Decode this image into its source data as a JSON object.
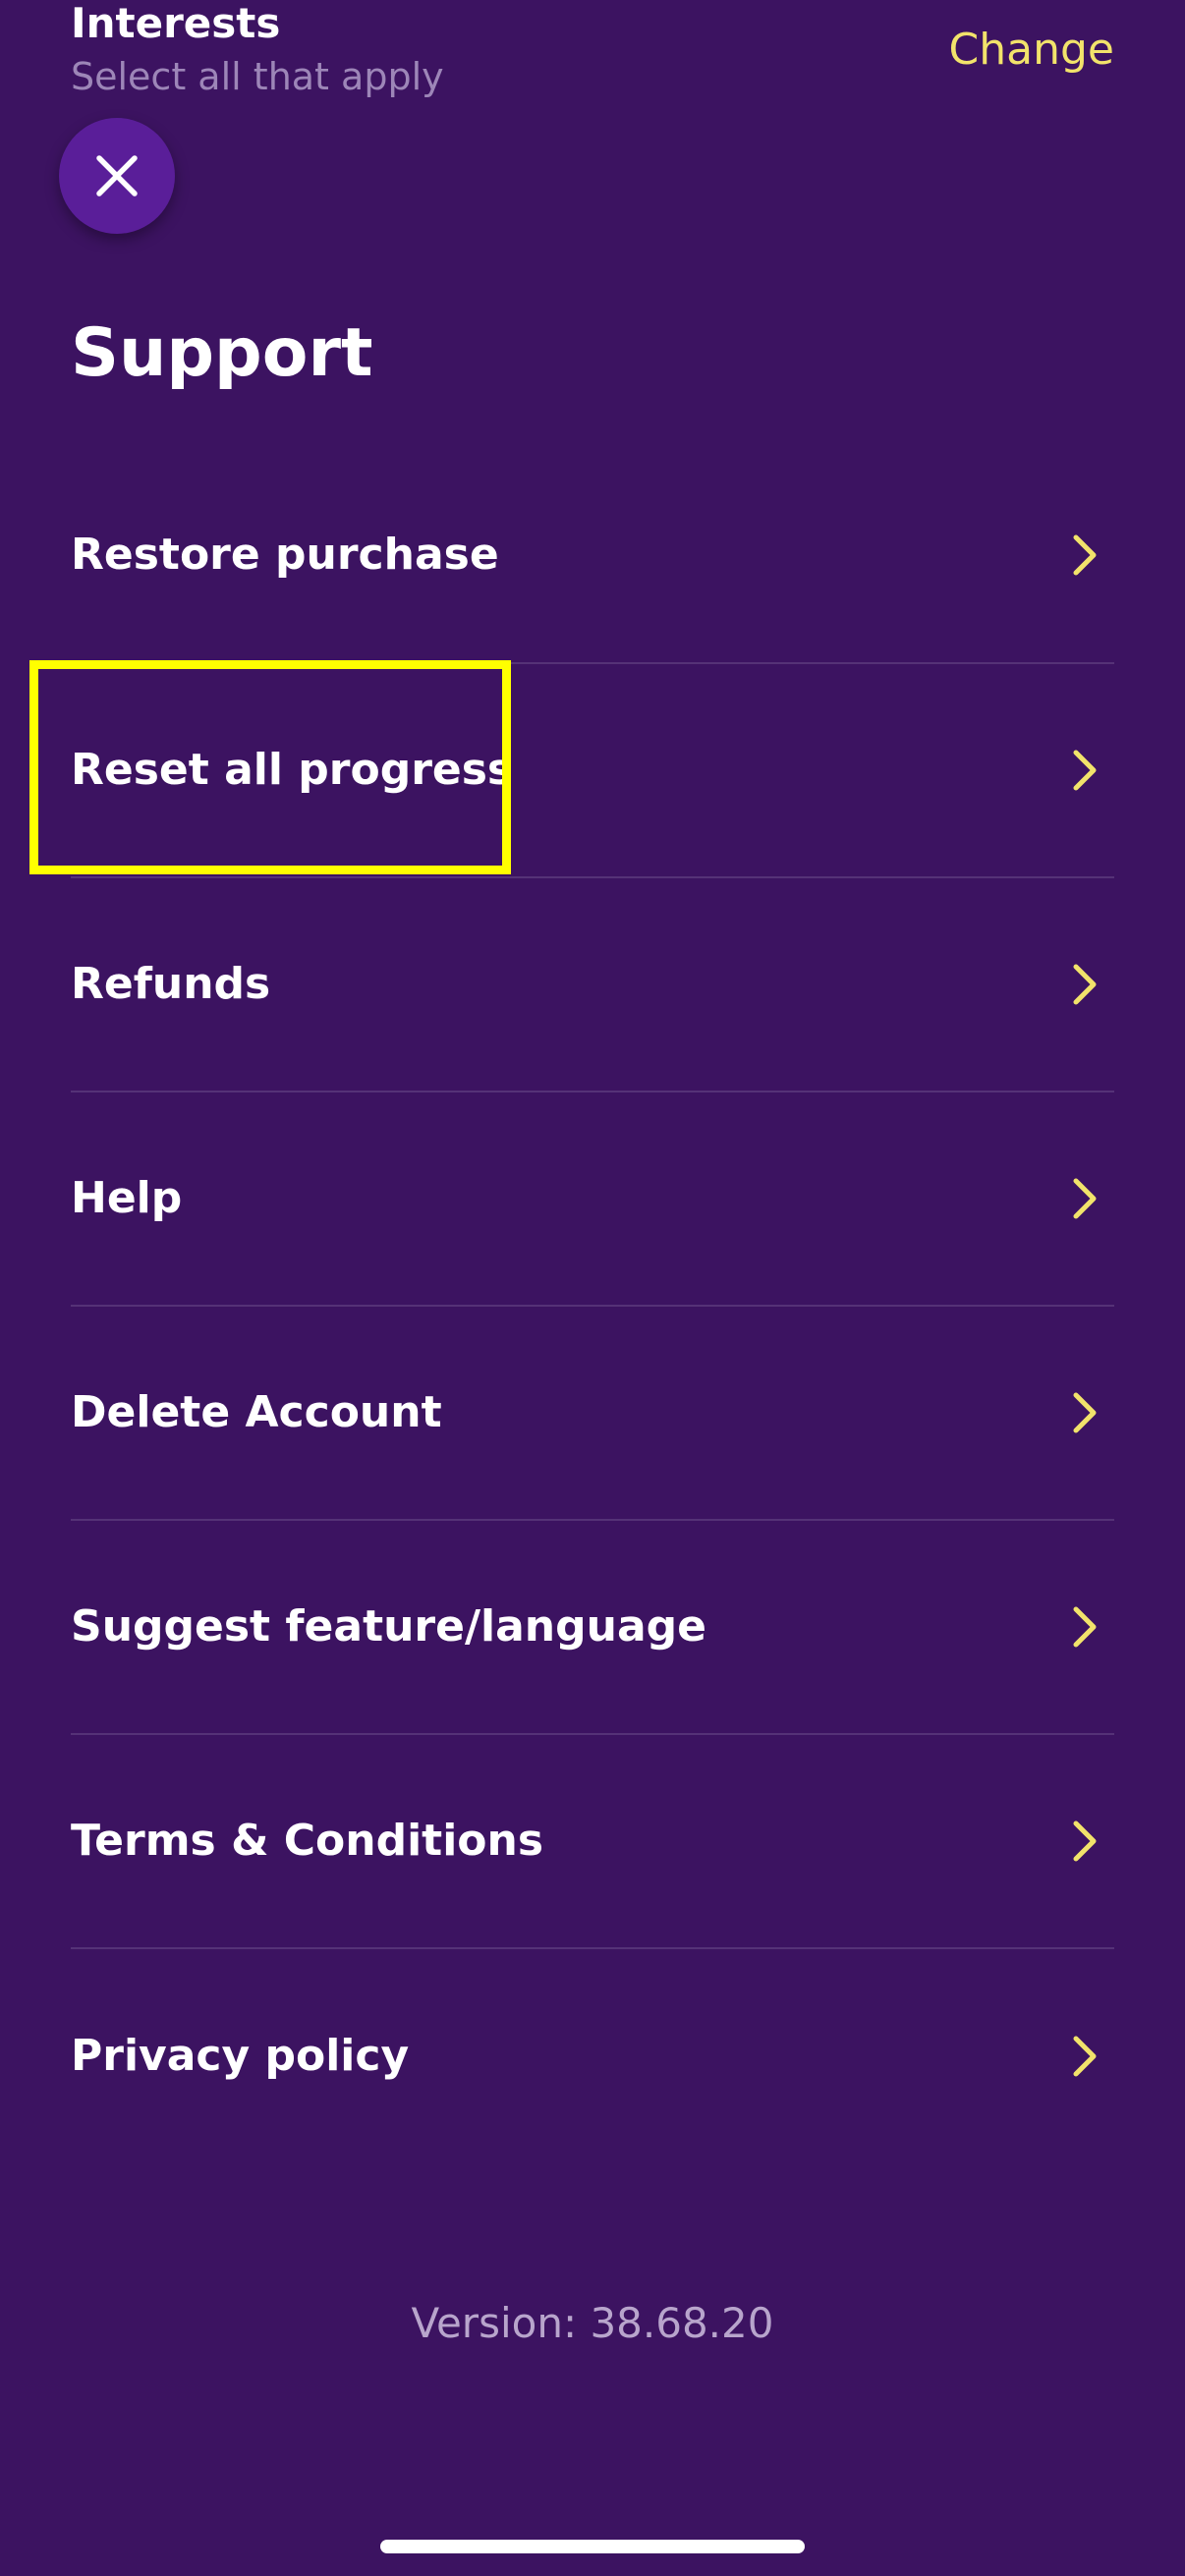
{
  "header": {
    "interests_title": "Interests",
    "interests_subtitle": "Select all that apply",
    "change_label": "Change"
  },
  "close_icon": "close-icon",
  "page": {
    "title": "Support"
  },
  "menu": {
    "items": [
      {
        "label": "Restore purchase",
        "icon": "chevron-right-icon"
      },
      {
        "label": "Reset all progress",
        "icon": "chevron-right-icon"
      },
      {
        "label": "Refunds",
        "icon": "chevron-right-icon"
      },
      {
        "label": "Help",
        "icon": "chevron-right-icon"
      },
      {
        "label": "Delete Account",
        "icon": "chevron-right-icon"
      },
      {
        "label": "Suggest feature/language",
        "icon": "chevron-right-icon"
      },
      {
        "label": "Terms & Conditions",
        "icon": "chevron-right-icon"
      },
      {
        "label": "Privacy policy",
        "icon": "chevron-right-icon"
      }
    ]
  },
  "footer": {
    "version": "Version: 38.68.20"
  },
  "colors": {
    "background": "#3c1361",
    "accent": "#f2e36b",
    "close_button": "#5a1e99",
    "divider": "#553277",
    "highlight": "#ffff00"
  }
}
